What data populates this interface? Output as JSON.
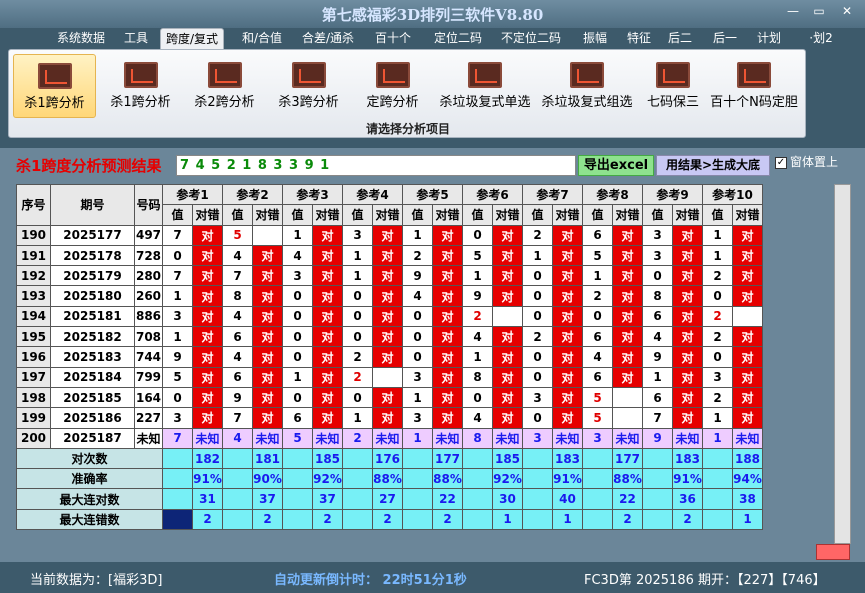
{
  "window": {
    "title": "第七感福彩3D排列三软件V8.80",
    "minimize": "—",
    "maximize": "▭",
    "close": "✕"
  },
  "menu": [
    "系统数据",
    "工具",
    "跨度/复式",
    "和/合值",
    "合差/通杀",
    "百十个",
    "定位二码",
    "不定位二码",
    "振幅",
    "特征",
    "后二",
    "后一",
    "计划",
    "·划2"
  ],
  "menu_active": "跨度/复式",
  "ribbon": {
    "buttons": [
      "杀1跨分析",
      "杀1跨分析",
      "杀2跨分析",
      "杀3跨分析",
      "定跨分析",
      "杀垃圾复式单选",
      "杀垃圾复式组选",
      "七码保三",
      "百十个N码定胆"
    ],
    "active_index": 0,
    "group_caption": "请选择分析项目"
  },
  "result": {
    "title": "杀1跨度分析预测结果",
    "values": "7 4 5 2 1 8 3 3 9 1",
    "excel_button": "导出excel",
    "generate_button": "用结果>生成大底",
    "ontop_label": "窗体置上",
    "ontop_checked": "✓"
  },
  "table": {
    "head": {
      "seq": "序号",
      "issue": "期号",
      "code": "号码",
      "refs": [
        "参考1",
        "参考2",
        "参考3",
        "参考4",
        "参考5",
        "参考6",
        "参考7",
        "参考8",
        "参考9",
        "参考10"
      ],
      "val": "值",
      "check": "对错"
    },
    "rows": [
      {
        "seq": "190",
        "issue": "2025177",
        "code": "497",
        "v": [
          "7",
          "5",
          "1",
          "3",
          "1",
          "0",
          "2",
          "6",
          "3",
          "1"
        ],
        "ok": [
          1,
          0,
          1,
          1,
          1,
          1,
          1,
          1,
          1,
          1
        ]
      },
      {
        "seq": "191",
        "issue": "2025178",
        "code": "728",
        "v": [
          "0",
          "4",
          "4",
          "1",
          "2",
          "5",
          "1",
          "5",
          "3",
          "1"
        ],
        "ok": [
          1,
          1,
          1,
          1,
          1,
          1,
          1,
          1,
          1,
          1
        ]
      },
      {
        "seq": "192",
        "issue": "2025179",
        "code": "280",
        "v": [
          "7",
          "7",
          "3",
          "1",
          "9",
          "1",
          "0",
          "1",
          "0",
          "2"
        ],
        "ok": [
          1,
          1,
          1,
          1,
          1,
          1,
          1,
          1,
          1,
          1
        ]
      },
      {
        "seq": "193",
        "issue": "2025180",
        "code": "260",
        "v": [
          "1",
          "8",
          "0",
          "0",
          "4",
          "9",
          "0",
          "2",
          "8",
          "0"
        ],
        "ok": [
          1,
          1,
          1,
          1,
          1,
          1,
          1,
          1,
          1,
          1
        ]
      },
      {
        "seq": "194",
        "issue": "2025181",
        "code": "886",
        "v": [
          "3",
          "4",
          "0",
          "0",
          "0",
          "2",
          "0",
          "0",
          "6",
          "2"
        ],
        "ok": [
          1,
          1,
          1,
          1,
          1,
          0,
          1,
          1,
          1,
          0
        ]
      },
      {
        "seq": "195",
        "issue": "2025182",
        "code": "708",
        "v": [
          "1",
          "6",
          "0",
          "0",
          "0",
          "4",
          "2",
          "6",
          "4",
          "2"
        ],
        "ok": [
          1,
          1,
          1,
          1,
          1,
          1,
          1,
          1,
          1,
          1
        ]
      },
      {
        "seq": "196",
        "issue": "2025183",
        "code": "744",
        "v": [
          "9",
          "4",
          "0",
          "2",
          "0",
          "1",
          "0",
          "4",
          "9",
          "0"
        ],
        "ok": [
          1,
          1,
          1,
          1,
          1,
          1,
          1,
          1,
          1,
          1
        ]
      },
      {
        "seq": "197",
        "issue": "2025184",
        "code": "799",
        "v": [
          "5",
          "6",
          "1",
          "2",
          "3",
          "8",
          "0",
          "6",
          "1",
          "3"
        ],
        "ok": [
          1,
          1,
          1,
          0,
          1,
          1,
          1,
          1,
          1,
          1
        ]
      },
      {
        "seq": "198",
        "issue": "2025185",
        "code": "164",
        "v": [
          "0",
          "9",
          "0",
          "0",
          "1",
          "0",
          "3",
          "5",
          "6",
          "2"
        ],
        "ok": [
          1,
          1,
          1,
          1,
          1,
          1,
          1,
          0,
          1,
          1
        ]
      },
      {
        "seq": "199",
        "issue": "2025186",
        "code": "227",
        "v": [
          "3",
          "7",
          "6",
          "1",
          "3",
          "4",
          "0",
          "5",
          "7",
          "1"
        ],
        "ok": [
          1,
          1,
          1,
          1,
          1,
          1,
          1,
          0,
          1,
          1
        ]
      }
    ],
    "pending": {
      "seq": "200",
      "issue": "2025187",
      "code": "未知",
      "v": [
        "7",
        "4",
        "5",
        "2",
        "1",
        "8",
        "3",
        "3",
        "9",
        "1"
      ],
      "check": "未知"
    },
    "check_ok": "对",
    "summary": [
      {
        "label": "对次数",
        "values": [
          "182",
          "181",
          "185",
          "176",
          "177",
          "185",
          "183",
          "177",
          "183",
          "188"
        ]
      },
      {
        "label": "准确率",
        "values": [
          "91%",
          "90%",
          "92%",
          "88%",
          "88%",
          "92%",
          "91%",
          "88%",
          "91%",
          "94%"
        ]
      },
      {
        "label": "最大连对数",
        "values": [
          "31",
          "37",
          "37",
          "27",
          "22",
          "30",
          "40",
          "22",
          "36",
          "38"
        ]
      },
      {
        "label": "最大连错数",
        "values": [
          "2",
          "2",
          "2",
          "2",
          "2",
          "1",
          "1",
          "2",
          "2",
          "1"
        ]
      }
    ]
  },
  "status": {
    "current_label": "当前数据为：[福彩3D]",
    "countdown": "自动更新倒计时：  22时51分1秒",
    "latest": "FC3D第 2025186 期开：【227】【746】"
  },
  "colors": {
    "wrong_cell": "#e60000",
    "pending_row": "#eeccff",
    "summary": "#77f0f6",
    "result_title": "#e60000"
  }
}
